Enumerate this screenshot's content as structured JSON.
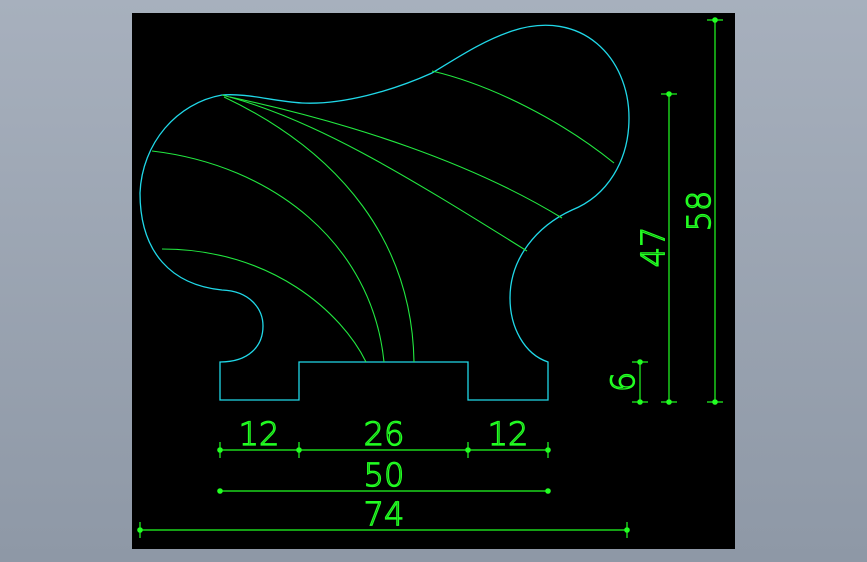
{
  "drawing": {
    "colors": {
      "background": "#000000",
      "outline": "#20d8e8",
      "dimension": "#22ff22",
      "grain_lines": "#22e840"
    },
    "dimensions": {
      "base_left": "12",
      "base_center": "26",
      "base_right": "12",
      "base_width": "50",
      "outer_width": "74",
      "overall_height": "58",
      "profile_height": "47",
      "base_height": "6"
    }
  }
}
